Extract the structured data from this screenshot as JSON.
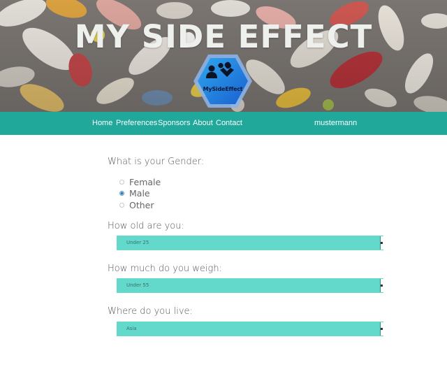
{
  "banner": {
    "title": "MY SIDE EFFECT",
    "logo_text": "MySideEffect",
    "logo_icon": "user-and-pills-icon"
  },
  "nav": {
    "items": [
      "Home",
      "Preferences",
      "Sponsors",
      "About",
      "Contact"
    ],
    "username": "mustermann"
  },
  "form": {
    "gender": {
      "question": "What is your Gender:",
      "options": [
        "Female",
        "Male",
        "Other"
      ],
      "selected": "Male"
    },
    "age": {
      "question": "How old are you:",
      "value": "Under 25"
    },
    "weight": {
      "question": "How much do you weigh:",
      "value": "Under 55"
    },
    "location": {
      "question": "Where do you live:",
      "value": "Asia"
    }
  },
  "colors": {
    "navbar": "#20a89b",
    "select_fill": "#62d9cb",
    "logo_blue": "#1e7be0",
    "radio_checked": "#2f7fb6"
  }
}
